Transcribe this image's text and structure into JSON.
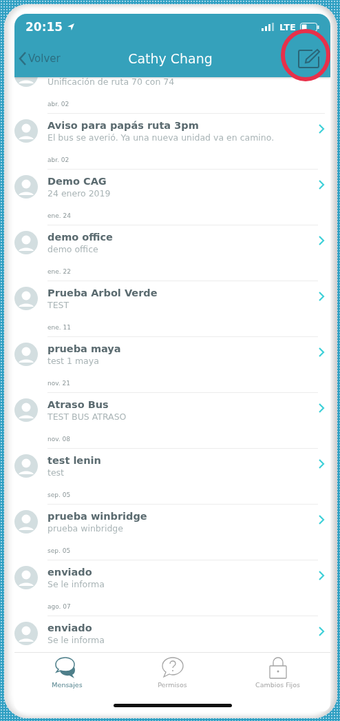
{
  "status_bar": {
    "time": "20:15",
    "network": "LTE"
  },
  "nav_bar": {
    "back": "Volver",
    "title": "Cathy Chang"
  },
  "messages": [
    {
      "kind": "partial",
      "subtitle": "Unificación de ruta 70 con 74",
      "date": "abr. 02"
    },
    {
      "kind": "full",
      "title": "Aviso para papás ruta 3pm",
      "subtitle": "El bus se averió. Ya una nueva unidad va en camino.",
      "date": "abr. 02"
    },
    {
      "kind": "full",
      "title": "Demo CAG",
      "subtitle": "24 enero 2019",
      "date": "ene. 24"
    },
    {
      "kind": "full",
      "title": "demo office",
      "subtitle": "demo office",
      "date": "ene. 22"
    },
    {
      "kind": "full",
      "title": "Prueba Arbol Verde",
      "subtitle": "TEST",
      "date": "ene. 11"
    },
    {
      "kind": "full",
      "title": "prueba maya",
      "subtitle": "test 1 maya",
      "date": "nov. 21"
    },
    {
      "kind": "full",
      "title": "Atraso Bus",
      "subtitle": "TEST BUS ATRASO",
      "date": "nov. 08"
    },
    {
      "kind": "full",
      "title": "test lenin",
      "subtitle": "test",
      "date": "sep. 05"
    },
    {
      "kind": "full",
      "title": "prueba winbridge",
      "subtitle": "prueba winbridge",
      "date": "sep. 05"
    },
    {
      "kind": "full",
      "title": "enviado",
      "subtitle": "Se le informa",
      "date": "ago. 07"
    },
    {
      "kind": "full",
      "title": "enviado",
      "subtitle": "Se le informa"
    }
  ],
  "tab_bar": [
    {
      "kind": "messages",
      "label": "Mensajes",
      "selected": true
    },
    {
      "kind": "help",
      "label": "Permisos",
      "selected": false
    },
    {
      "kind": "lock",
      "label": "Cambios Fijos",
      "selected": false
    }
  ]
}
